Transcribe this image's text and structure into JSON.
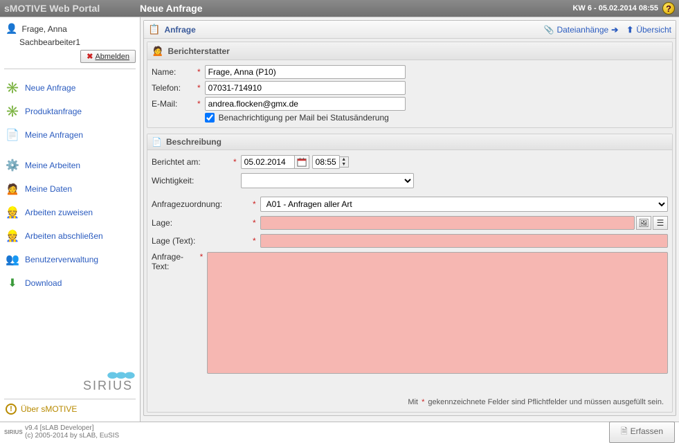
{
  "header": {
    "brand": "sMOTIVE Web Portal",
    "title": "Neue Anfrage",
    "date": "KW 6 - 05.02.2014 08:55"
  },
  "user": {
    "name": "Frage, Anna",
    "role": "Sachbearbeiter1",
    "logout": "Abmelden"
  },
  "sidebar": {
    "items": [
      {
        "label": "Neue Anfrage"
      },
      {
        "label": "Produktanfrage"
      },
      {
        "label": "Meine Anfragen"
      },
      {
        "label": "Meine Arbeiten"
      },
      {
        "label": "Meine Daten"
      },
      {
        "label": "Arbeiten zuweisen"
      },
      {
        "label": "Arbeiten abschließen"
      },
      {
        "label": "Benutzerverwaltung"
      },
      {
        "label": "Download"
      }
    ],
    "sirius": "SIRIUS",
    "about": "Über sMOTIVE"
  },
  "main": {
    "panel_title": "Anfrage",
    "links": {
      "attachments": "Dateianhänge",
      "overview": "Übersicht"
    },
    "reporter_section": "Berichterstatter",
    "description_section": "Beschreibung",
    "labels": {
      "name": "Name:",
      "phone": "Telefon:",
      "email": "E-Mail:",
      "notify": "Benachrichtigung per Mail bei Statusänderung",
      "reported": "Berichtet am:",
      "importance": "Wichtigkeit:",
      "category": "Anfragezuordnung:",
      "location": "Lage:",
      "location_text": "Lage (Text):",
      "request_text": "Anfrage-Text:"
    },
    "values": {
      "name": "Frage, Anna (P10)",
      "phone": "07031-714910",
      "email": "andrea.flocken@gmx.de",
      "notify_checked": true,
      "reported_date": "05.02.2014",
      "reported_time": "08:55",
      "importance": "",
      "category": "A01 - Anfragen aller Art",
      "location": "",
      "location_text": "",
      "request_text": ""
    },
    "hint_pre": "Mit",
    "hint_post": "gekennzeichnete Felder sind Pflichtfelder und müssen ausgefüllt sein."
  },
  "footer": {
    "version": "v9.4 [sLAB Developer]",
    "copyright": "(c) 2005-2014 by sLAB, EuSIS",
    "submit": "Erfassen",
    "logo": "SIRIUS"
  }
}
